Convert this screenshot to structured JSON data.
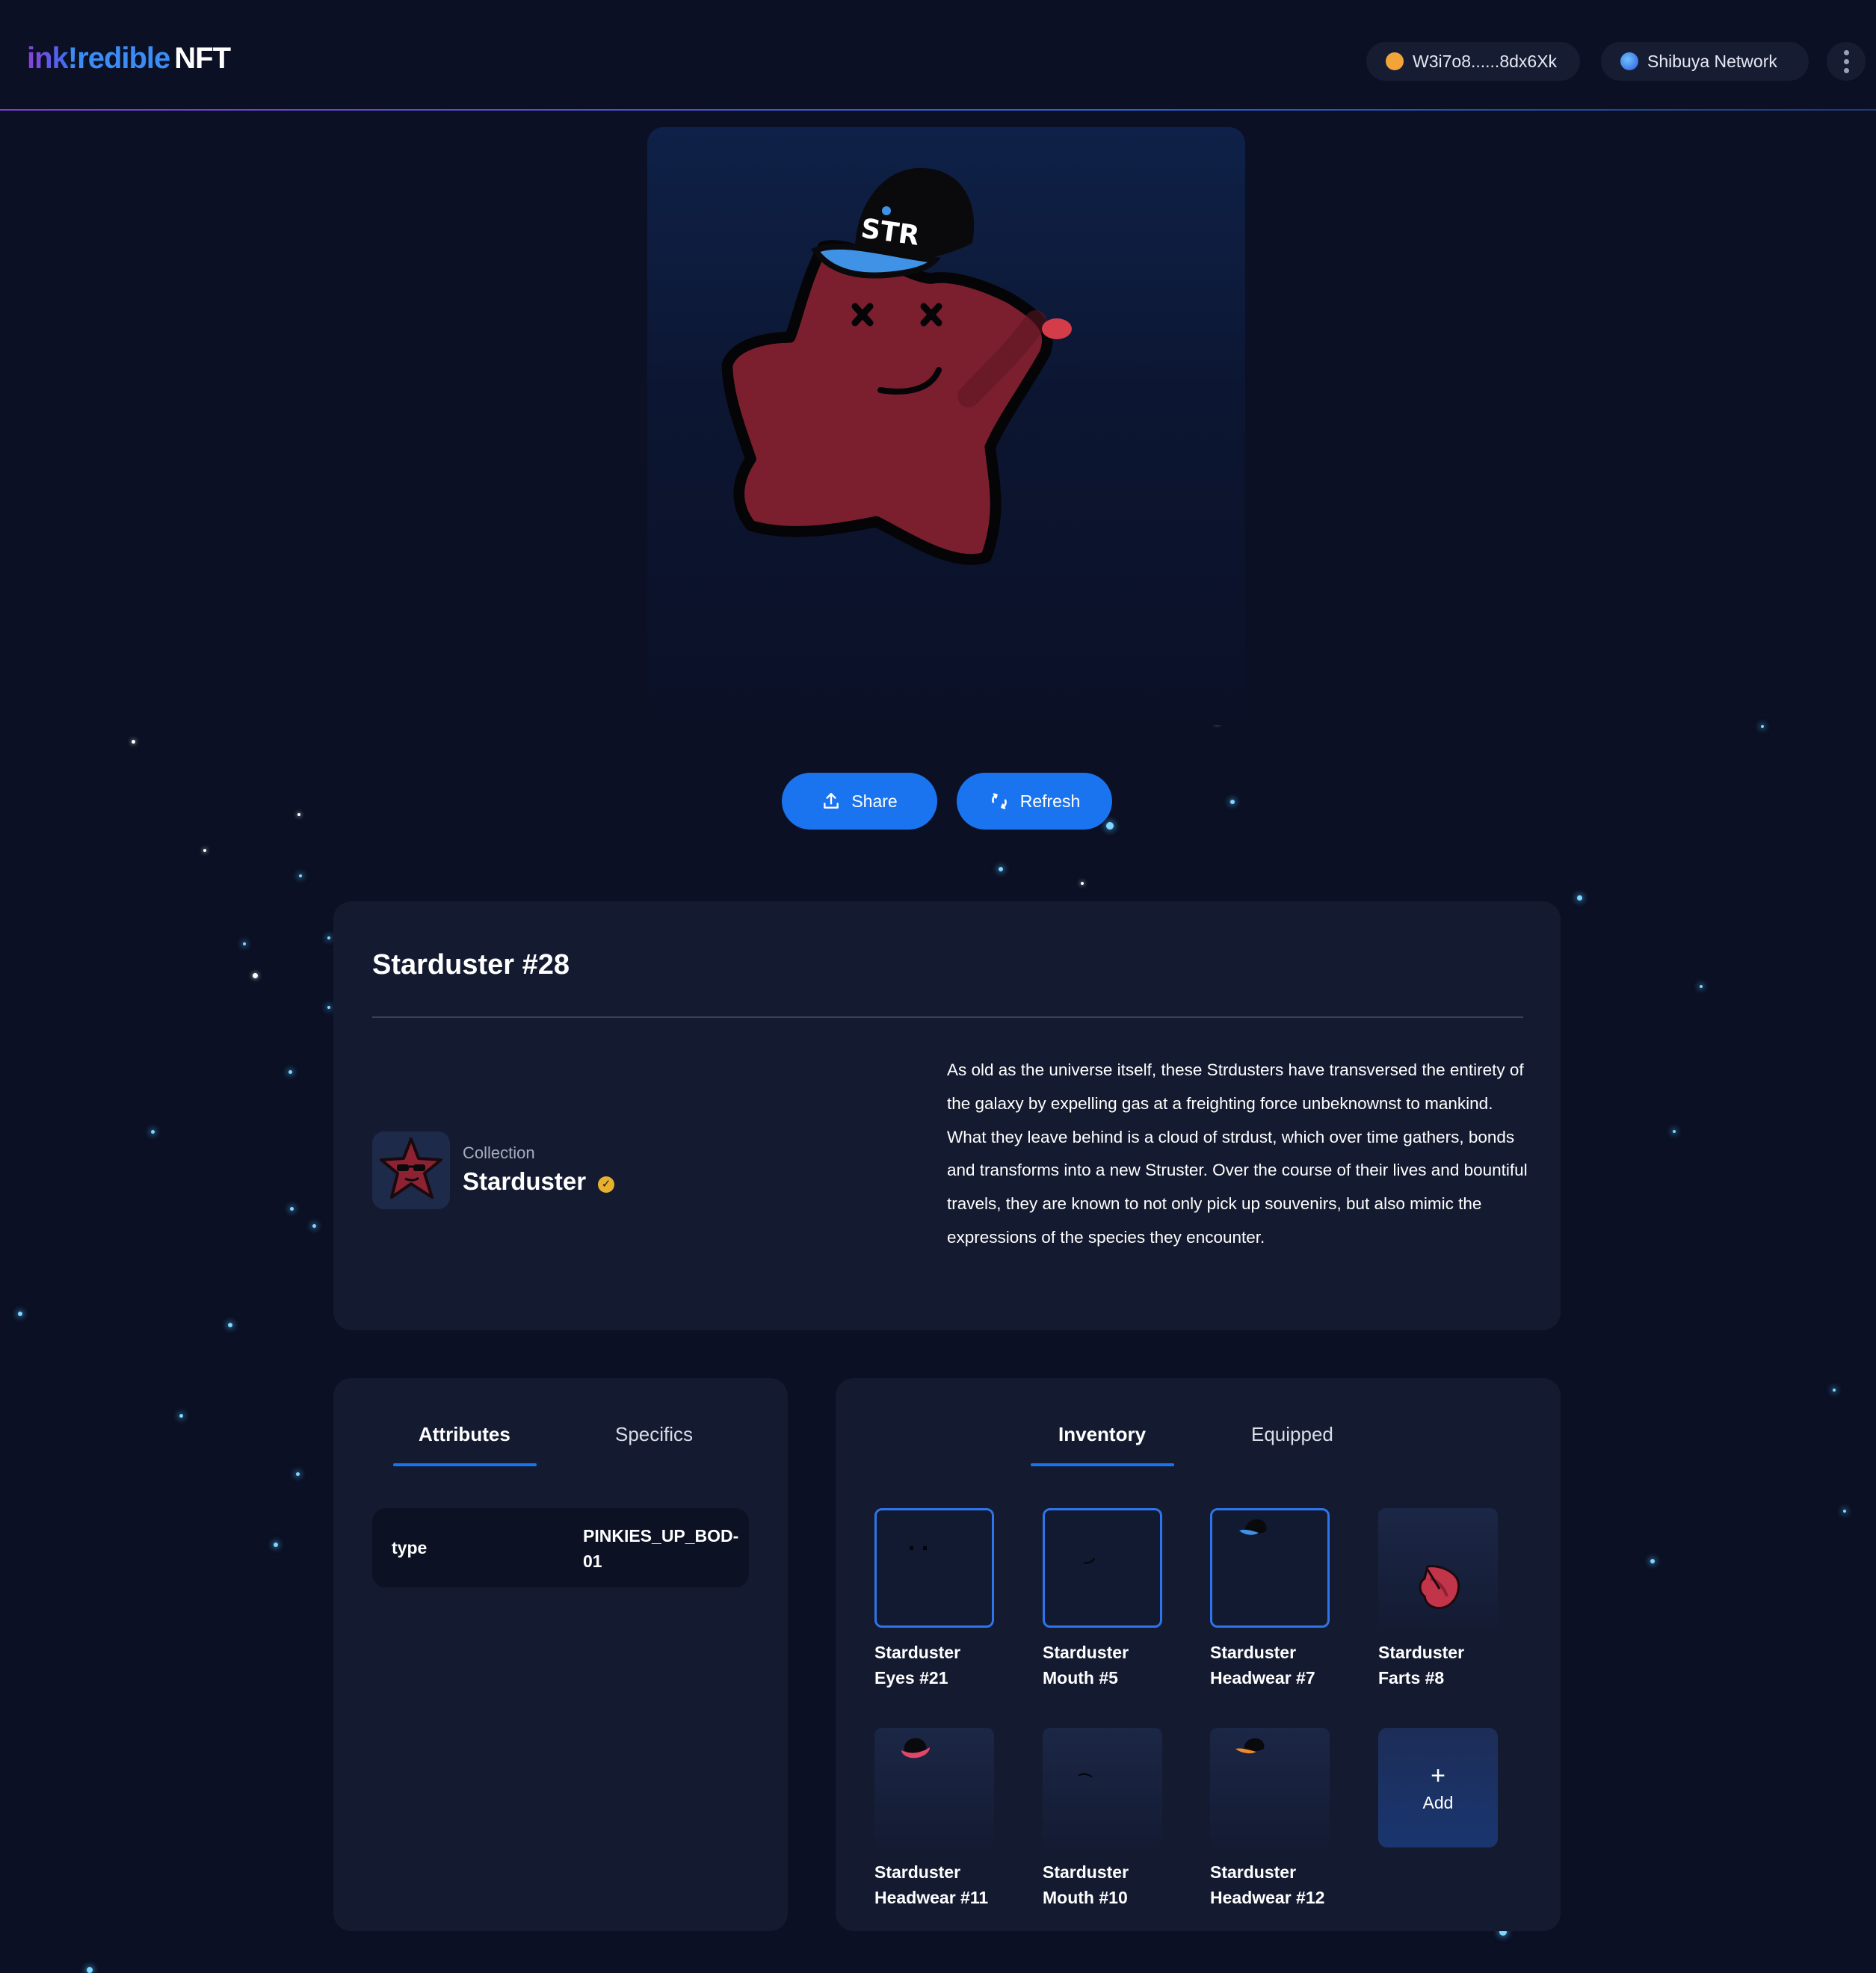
{
  "header": {
    "logo_part1": "ink",
    "logo_part2": "!",
    "logo_part3": "redible",
    "logo_part4": "NFT",
    "wallet_address": "W3i7o8......8dx6Xk",
    "network": "Shibuya Network"
  },
  "actions": {
    "share_label": "Share",
    "refresh_label": "Refresh"
  },
  "nft": {
    "title": "Starduster #28",
    "collection_label": "Collection",
    "collection_name": "Starduster",
    "description": "As old as the universe itself, these Strdusters have transversed the entirety of the galaxy by expelling gas at a freighting force unbeknownst to mankind. What they leave behind is a cloud of strdust, which over time gathers, bonds and transforms into a new Struster. Over the course of their lives and bountiful travels, they are known to not only pick up souvenirs, but also mimic the expressions of the species they encounter."
  },
  "attributes_panel": {
    "tabs": [
      {
        "label": "Attributes",
        "active": true
      },
      {
        "label": "Specifics",
        "active": false
      }
    ],
    "rows": [
      {
        "key": "type",
        "value": "PINKIES_UP_BOD-01"
      }
    ]
  },
  "inventory_panel": {
    "tabs": [
      {
        "label": "Inventory",
        "active": true
      },
      {
        "label": "Equipped",
        "active": false
      }
    ],
    "items": [
      {
        "name": "Starduster Eyes #21",
        "selected": true,
        "icon": "eyes-part-icon"
      },
      {
        "name": "Starduster Mouth #5",
        "selected": true,
        "icon": "mouth-part-icon"
      },
      {
        "name": "Starduster Headwear #7",
        "selected": true,
        "icon": "cap-icon"
      },
      {
        "name": "Starduster Farts #8",
        "selected": false,
        "icon": "fart-cloud-icon"
      },
      {
        "name": "Starduster Headwear #11",
        "selected": false,
        "icon": "pink-hat-icon"
      },
      {
        "name": "Starduster Mouth #10",
        "selected": false,
        "icon": "mouth-part-icon"
      },
      {
        "name": "Starduster Headwear #12",
        "selected": false,
        "icon": "orange-cap-icon"
      }
    ],
    "add_label": "Add",
    "add_icon": "+"
  },
  "colors": {
    "background": "#0b1024",
    "card": "#141b30",
    "accent": "#1a74f0",
    "verified": "#e7b12e",
    "star_red": "#7b1f2e"
  }
}
